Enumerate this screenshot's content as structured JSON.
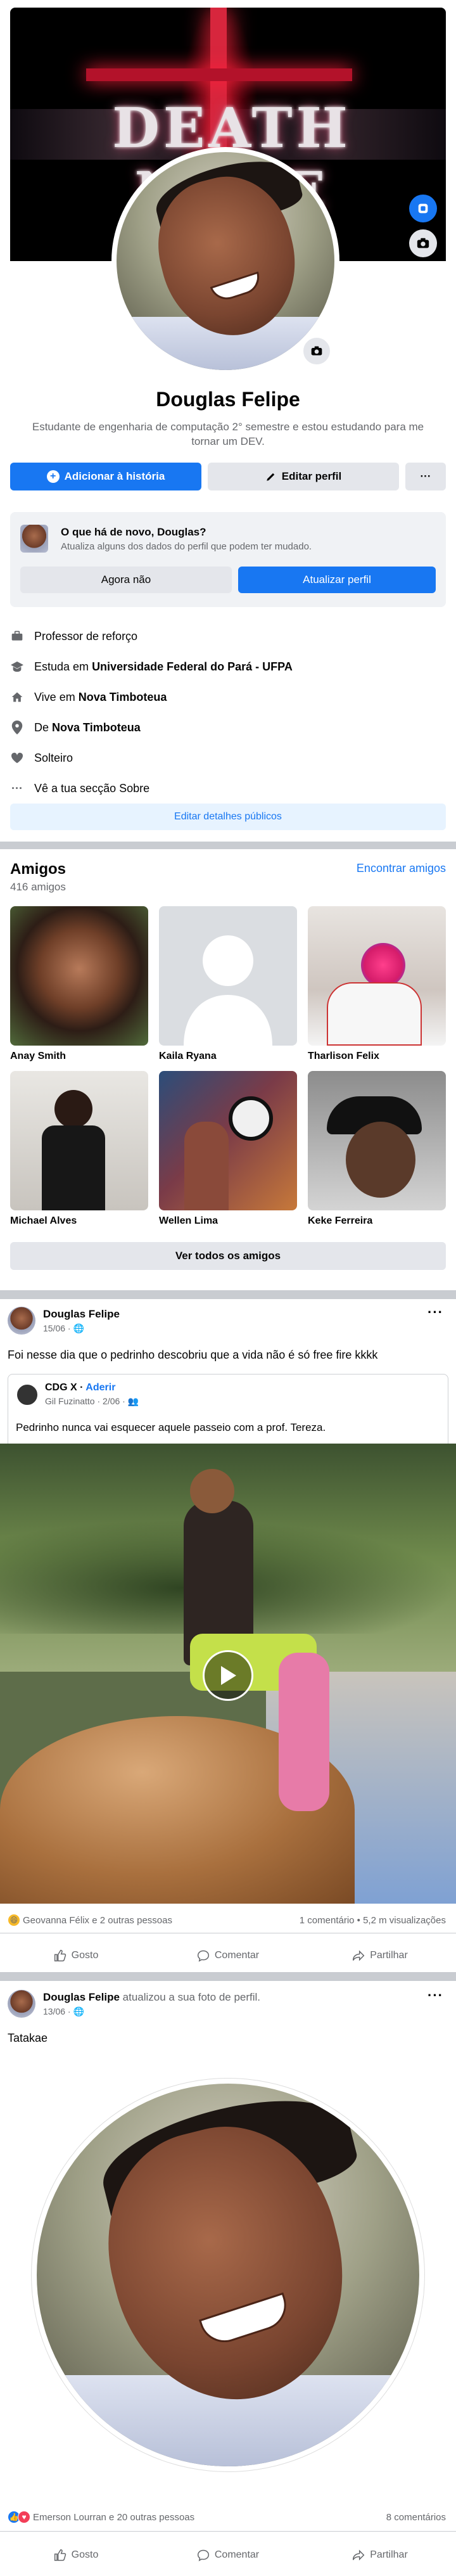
{
  "profile": {
    "cover_title": "DEATH NOTE",
    "name": "Douglas Felipe",
    "bio": "Estudante de engenharia de computação 2° semestre e estou estudando para me tornar um DEV.",
    "add_story_label": "Adicionar à história",
    "edit_profile_label": "Editar perfil",
    "more_label": "···"
  },
  "update_card": {
    "title": "O que há de novo, Douglas?",
    "subtitle": "Atualiza alguns dos dados do perfil que podem ter mudado.",
    "not_now_label": "Agora não",
    "update_label": "Atualizar perfil"
  },
  "details": {
    "job": "Professor de reforço",
    "study_prefix": "Estuda em",
    "study_value": "Universidade Federal do Pará - UFPA",
    "lives_prefix": "Vive em",
    "lives_value": "Nova Timboteua",
    "from_prefix": "De",
    "from_value": "Nova Timboteua",
    "relationship": "Solteiro",
    "about_link": "Vê a tua secção Sobre",
    "edit_public_label": "Editar detalhes públicos"
  },
  "friends": {
    "title": "Amigos",
    "count": "416 amigos",
    "find_label": "Encontrar amigos",
    "see_all_label": "Ver todos os amigos",
    "items": [
      {
        "name": "Anay Smith"
      },
      {
        "name": "Kaila Ryana"
      },
      {
        "name": "Tharlison Felix"
      },
      {
        "name": "Michael Alves"
      },
      {
        "name": "Wellen Lima"
      },
      {
        "name": "Keke Ferreira"
      }
    ]
  },
  "post1": {
    "author": "Douglas Felipe",
    "meta": "15/06 · ",
    "text": "Foi nesse dia que o pedrinho descobriu que a vida não é só free fire kkkk",
    "shared_group": "CDG X",
    "shared_join": "Aderir",
    "shared_meta": "Gil Fuzinatto · 2/06 · ",
    "shared_text": "Pedrinho nunca vai esquecer aquele passeio com a prof. Tereza.",
    "reactions": "Geovanna Félix e 2 outras pessoas",
    "stats": "1 comentário • 5,2 m visualizações"
  },
  "post2": {
    "author": "Douglas Felipe",
    "action": "atualizou a sua foto de perfil.",
    "meta": "13/06 · ",
    "text": "Tatakae",
    "reactions": "Emerson Lourran e 20 outras pessoas",
    "stats": "8 comentários"
  },
  "actions": {
    "like": "Gosto",
    "comment": "Comentar",
    "share": "Partilhar"
  },
  "colors": {
    "accent": "#1877f2",
    "secondary_bg": "#e4e6eb",
    "muted_text": "#65676b"
  }
}
